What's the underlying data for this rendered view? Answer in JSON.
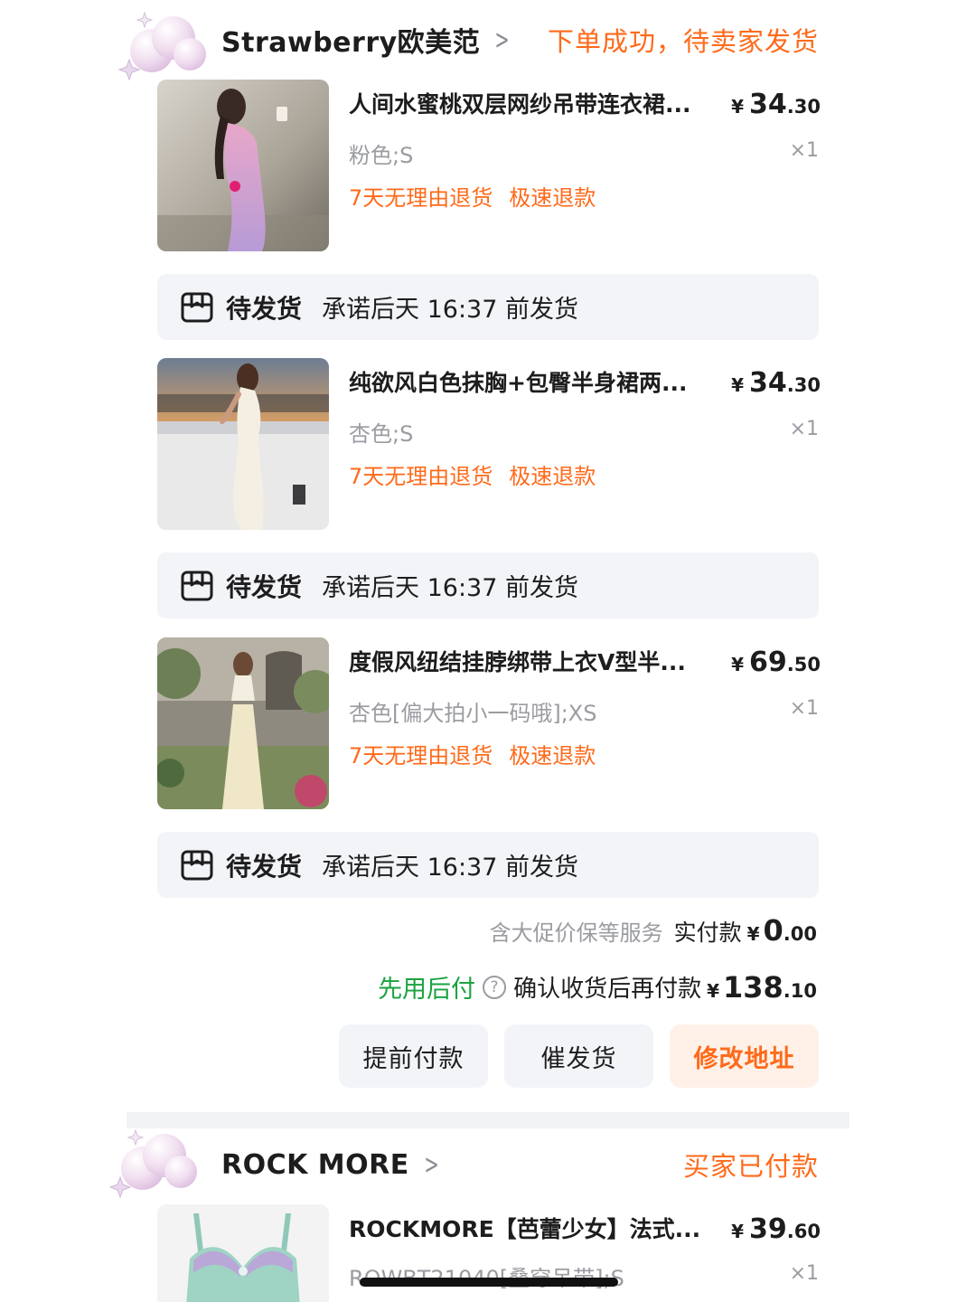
{
  "orders": [
    {
      "shop_name": "Strawberry欧美范",
      "status": "下单成功，待卖家发货",
      "items": [
        {
          "title": "人间水蜜桃双层网纱吊带连衣裙...",
          "price_currency": "¥",
          "price_int": "34",
          "price_dec": ".30",
          "variant": "粉色;S",
          "qty": "×1",
          "tag_return": "7天无理由退货",
          "tag_refund": "极速退款",
          "shipping_status": "待发货",
          "shipping_promise": "承诺后天 16:37 前发货"
        },
        {
          "title": "纯欲风白色抹胸+包臀半身裙两...",
          "price_currency": "¥",
          "price_int": "34",
          "price_dec": ".30",
          "variant": "杏色;S",
          "qty": "×1",
          "tag_return": "7天无理由退货",
          "tag_refund": "极速退款",
          "shipping_status": "待发货",
          "shipping_promise": "承诺后天 16:37 前发货"
        },
        {
          "title": "度假风纽结挂脖绑带上衣V型半...",
          "price_currency": "¥",
          "price_int": "69",
          "price_dec": ".50",
          "variant": "杏色[偏大拍小一码哦];XS",
          "qty": "×1",
          "tag_return": "7天无理由退货",
          "tag_refund": "极速退款",
          "shipping_status": "待发货",
          "shipping_promise": "承诺后天 16:37 前发货"
        }
      ],
      "service_note": "含大促价保等服务",
      "paid_label": "实付款",
      "paid_currency": "¥",
      "paid_int": "0",
      "paid_dec": ".00",
      "bnpl_label": "先用后付",
      "bnpl_help_glyph": "?",
      "confirm_label": "确认收货后再付款",
      "confirm_currency": "¥",
      "confirm_int": "138",
      "confirm_dec": ".10",
      "buttons": [
        "提前付款",
        "催发货",
        "修改地址"
      ]
    },
    {
      "shop_name": "ROCK MORE",
      "status": "买家已付款",
      "items": [
        {
          "title": "ROCKMORE【芭蕾少女】法式...",
          "price_currency": "¥",
          "price_int": "39",
          "price_dec": ".60",
          "variant": "ROWBT21040[叠穿吊带];S",
          "qty": "×1"
        }
      ]
    }
  ],
  "icons": {
    "chevron": "chevron-right-icon",
    "package": "package-box-icon",
    "help": "question-circle-icon",
    "sticker": "cloud-sparkle-sticker"
  },
  "colors": {
    "accent_orange": "#ff6a1a",
    "bnpl_green": "#19a33f",
    "panel_gray": "#f2f4f7",
    "text_dark": "#1d1d1f",
    "text_muted": "#9a9ca1"
  }
}
